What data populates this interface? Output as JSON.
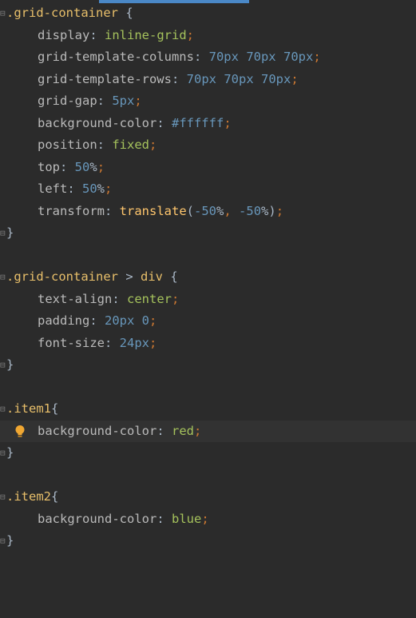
{
  "accent": "#4a88c7",
  "lines": {
    "l1": {
      "sel": ".grid-container",
      "brace": " {"
    },
    "l2": {
      "prop": "display",
      "colon": ": ",
      "val": "inline-grid",
      "semi": ";"
    },
    "l3": {
      "prop": "grid-template-columns",
      "colon": ": ",
      "n1": "70px",
      "sp1": " ",
      "n2": "70px",
      "sp2": " ",
      "n3": "70px",
      "semi": ";"
    },
    "l4": {
      "prop": "grid-template-rows",
      "colon": ": ",
      "n1": "70px",
      "sp1": " ",
      "n2": "70px",
      "sp2": " ",
      "n3": "70px",
      "semi": ";"
    },
    "l5": {
      "prop": "grid-gap",
      "colon": ": ",
      "n1": "5px",
      "semi": ";"
    },
    "l6": {
      "prop": "background-color",
      "colon": ": ",
      "hex": "#ffffff",
      "semi": ";"
    },
    "l7": {
      "prop": "position",
      "colon": ": ",
      "val": "fixed",
      "semi": ";"
    },
    "l8": {
      "prop": "top",
      "colon": ": ",
      "n1": "50",
      "pct": "%",
      "semi": ";"
    },
    "l9": {
      "prop": "left",
      "colon": ": ",
      "n1": "50",
      "pct": "%",
      "semi": ";"
    },
    "l10": {
      "prop": "transform",
      "colon": ": ",
      "fn": "translate",
      "open": "(",
      "n1": "-50",
      "pct1": "%",
      "comma": ", ",
      "n2": "-50",
      "pct2": "%",
      "close": ")",
      "semi": ";"
    },
    "l11": {
      "brace": "}"
    },
    "l13": {
      "sel": ".grid-container",
      "gt": " > ",
      "tag": "div",
      "brace": " {"
    },
    "l14": {
      "prop": "text-align",
      "colon": ": ",
      "val": "center",
      "semi": ";"
    },
    "l15": {
      "prop": "padding",
      "colon": ": ",
      "n1": "20px",
      "sp1": " ",
      "n2": "0",
      "semi": ";"
    },
    "l16": {
      "prop": "font-size",
      "colon": ": ",
      "n1": "24px",
      "semi": ";"
    },
    "l17": {
      "brace": "}"
    },
    "l19": {
      "sel": ".item1",
      "brace": "{"
    },
    "l20": {
      "prop": "background-color",
      "colon": ": ",
      "val": "red",
      "semi": ";"
    },
    "l21": {
      "brace": "}"
    },
    "l23": {
      "sel": ".item2",
      "brace": "{"
    },
    "l24": {
      "prop": "background-color",
      "colon": ": ",
      "val": "blue",
      "semi": ";"
    },
    "l25": {
      "brace": "}"
    }
  },
  "icons": {
    "bulb": "lightbulb-icon",
    "fold": "fold-arrow-icon"
  }
}
